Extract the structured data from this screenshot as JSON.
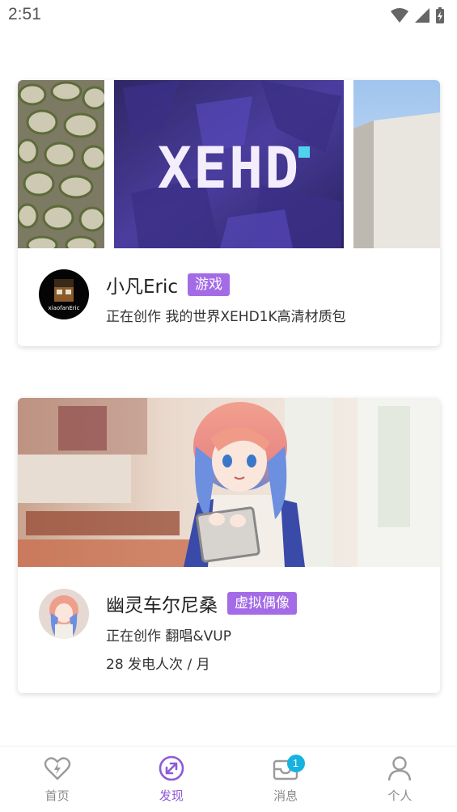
{
  "status_bar": {
    "time": "2:51"
  },
  "cards": [
    {
      "banner_text": "XEHD",
      "name": "小凡Eric",
      "tag": "游戏",
      "subtitle": "正在创作 我的世界XEHD1K高清材质包",
      "avatar_text": "xiaofanEric"
    },
    {
      "name": "幽灵车尔尼桑",
      "tag": "虚拟偶像",
      "subtitle": "正在创作 翻唱&VUP",
      "support": "28 发电人次 / 月"
    }
  ],
  "tabbar": {
    "tabs": [
      {
        "label": "首页",
        "icon": "heart-bolt-icon"
      },
      {
        "label": "发现",
        "icon": "discover-icon",
        "active": true
      },
      {
        "label": "消息",
        "icon": "message-icon",
        "badge": "1"
      },
      {
        "label": "个人",
        "icon": "person-icon"
      }
    ]
  },
  "colors": {
    "accent": "#a36be6",
    "badge": "#16b3e0"
  }
}
